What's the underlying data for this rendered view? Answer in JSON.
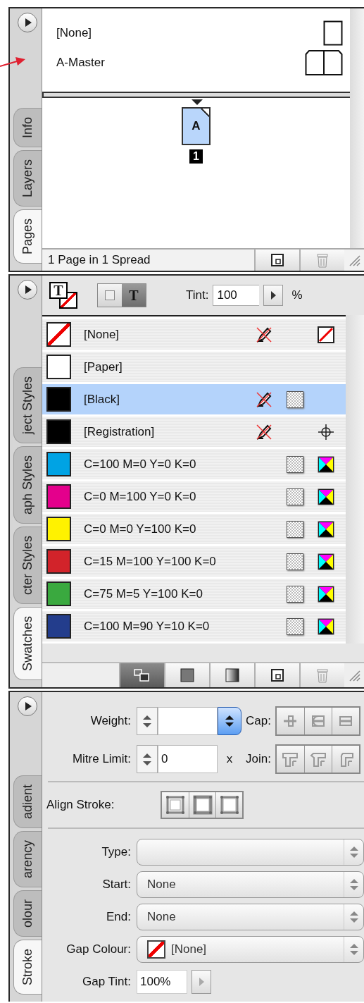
{
  "pages_panel": {
    "tabs": [
      {
        "label": "Info",
        "selected": false
      },
      {
        "label": "Layers",
        "selected": false
      },
      {
        "label": "Pages",
        "selected": true
      }
    ],
    "masters": [
      {
        "label": "[None]",
        "kind": "single"
      },
      {
        "label": "A-Master",
        "kind": "spread"
      }
    ],
    "pages": [
      {
        "master": "A",
        "number": "1",
        "selected": true
      }
    ],
    "status": "1 Page in 1 Spread"
  },
  "swatches_panel": {
    "tabs": [
      {
        "label": "ject Styles",
        "selected": false
      },
      {
        "label": "aph Styles",
        "selected": false
      },
      {
        "label": "cter Styles",
        "selected": false
      },
      {
        "label": "Swatches",
        "selected": true
      }
    ],
    "fill_stroke_label": "T",
    "targets": [
      {
        "kind": "container",
        "selected": false
      },
      {
        "kind": "text",
        "label": "T",
        "selected": true
      }
    ],
    "tint": {
      "label": "Tint:",
      "value": "100",
      "unit": "%"
    },
    "swatches": [
      {
        "name": "[None]",
        "kind": "none",
        "locked": true,
        "process": false,
        "model_icon": {
          "kind": "none"
        },
        "selected": false
      },
      {
        "name": "[Paper]",
        "kind": "color",
        "color": "#ffffff",
        "locked": false,
        "process": false,
        "selected": false
      },
      {
        "name": "[Black]",
        "kind": "color",
        "color": "#000000",
        "locked": true,
        "process": true,
        "selected": true
      },
      {
        "name": "[Registration]",
        "kind": "color",
        "color": "#000000",
        "locked": true,
        "process": false,
        "model_icon": {
          "kind": "registration"
        },
        "selected": false
      },
      {
        "name": "C=100 M=0 Y=0 K=0",
        "kind": "color",
        "color": "#00a3e4",
        "locked": false,
        "process": true,
        "model_icon": {
          "kind": "cmyk"
        },
        "selected": false
      },
      {
        "name": "C=0 M=100 Y=0 K=0",
        "kind": "color",
        "color": "#e4008c",
        "locked": false,
        "process": true,
        "model_icon": {
          "kind": "cmyk"
        },
        "selected": false
      },
      {
        "name": "C=0 M=0 Y=100 K=0",
        "kind": "color",
        "color": "#fff200",
        "locked": false,
        "process": true,
        "model_icon": {
          "kind": "cmyk"
        },
        "selected": false
      },
      {
        "name": "C=15 M=100 Y=100 K=0",
        "kind": "color",
        "color": "#d2232a",
        "locked": false,
        "process": true,
        "model_icon": {
          "kind": "cmyk"
        },
        "selected": false
      },
      {
        "name": "C=75 M=5 Y=100 K=0",
        "kind": "color",
        "color": "#3aa93f",
        "locked": false,
        "process": true,
        "model_icon": {
          "kind": "cmyk"
        },
        "selected": false
      },
      {
        "name": "C=100 M=90 Y=10 K=0",
        "kind": "color",
        "color": "#233d8c",
        "locked": false,
        "process": true,
        "model_icon": {
          "kind": "cmyk"
        },
        "selected": false
      }
    ],
    "filters": [
      {
        "kind": "all",
        "selected": true
      },
      {
        "kind": "color",
        "selected": false
      },
      {
        "kind": "gradient",
        "selected": false
      }
    ]
  },
  "stroke_panel": {
    "tabs": [
      {
        "label": "adient",
        "selected": false
      },
      {
        "label": "arency",
        "selected": false
      },
      {
        "label": "olour",
        "selected": false
      },
      {
        "label": "Stroke",
        "selected": true
      }
    ],
    "weight": {
      "label": "Weight:"
    },
    "cap": {
      "label": "Cap:"
    },
    "mitre_limit": {
      "label": "Mitre Limit:",
      "value": "0",
      "unit": "x"
    },
    "join": {
      "label": "Join:"
    },
    "align_stroke": {
      "label": "Align Stroke:"
    },
    "selects": [
      {
        "label": "Type:"
      },
      {
        "label": "Start:",
        "value": "None"
      },
      {
        "label": "End:",
        "value": "None"
      },
      {
        "label": "Gap Colour:",
        "value": "[None]",
        "swatch": {
          "kind": "none"
        }
      }
    ],
    "gap_tint": {
      "label": "Gap Tint:",
      "value": "100%"
    }
  }
}
